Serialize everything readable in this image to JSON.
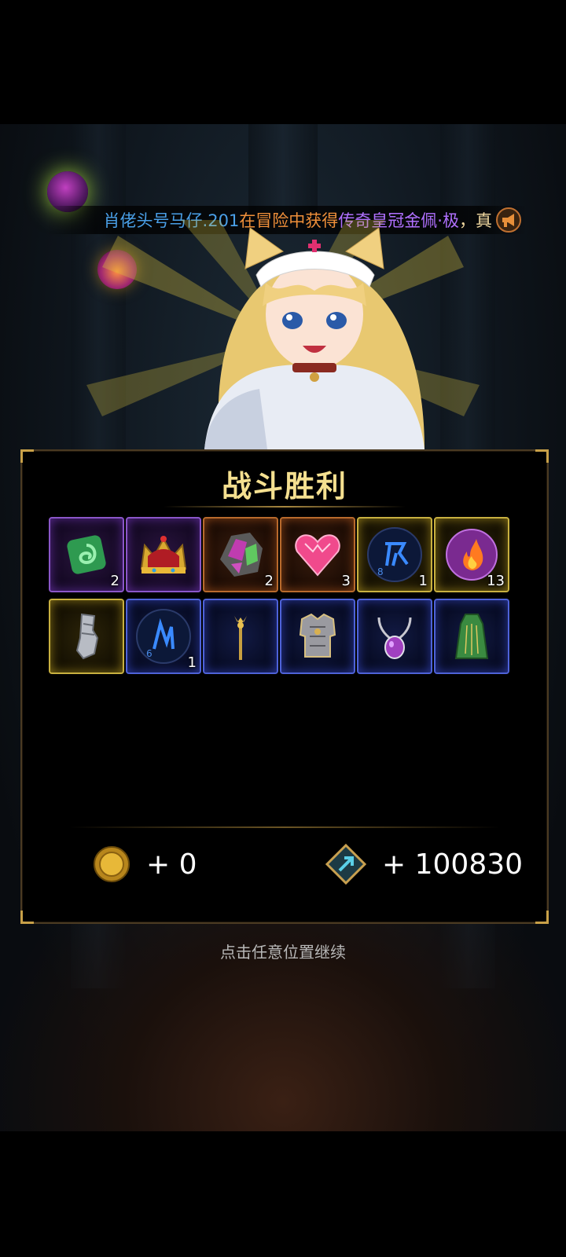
{
  "broadcast": {
    "player_name": "肖佬头号马仔.201",
    "action": "在冒险中获得",
    "item": "传奇皇冠金佩·极",
    "tail": "，真",
    "icon": "megaphone-icon"
  },
  "panel": {
    "title": "战斗胜利",
    "rows": [
      [
        {
          "icon": "green-rune-stone",
          "quality": "purple",
          "count": "2"
        },
        {
          "icon": "royal-crown",
          "quality": "purple",
          "count": ""
        },
        {
          "icon": "purple-crystal-ore",
          "quality": "orange",
          "count": "2"
        },
        {
          "icon": "pink-heart-gem",
          "quality": "orange",
          "count": "3"
        },
        {
          "icon": "blue-rune-orb-8",
          "quality": "gold",
          "count": "1"
        },
        {
          "icon": "fire-orb",
          "quality": "gold",
          "count": "13"
        }
      ],
      [
        {
          "icon": "steel-gauntlet",
          "quality": "gold",
          "count": ""
        },
        {
          "icon": "blue-rune-orb-6",
          "quality": "blue",
          "count": "1"
        },
        {
          "icon": "golden-scepter",
          "quality": "blue",
          "count": ""
        },
        {
          "icon": "silver-armor",
          "quality": "blue",
          "count": ""
        },
        {
          "icon": "amethyst-amulet",
          "quality": "blue",
          "count": ""
        },
        {
          "icon": "green-cloak",
          "quality": "blue",
          "count": ""
        }
      ]
    ],
    "rune_numbers": {
      "orb8": "8",
      "orb6": "6"
    },
    "rewards": {
      "gold": {
        "icon": "gold-coin-icon",
        "value": "+ 0"
      },
      "exp": {
        "icon": "exp-arrow-icon",
        "value": "+ 100830"
      }
    }
  },
  "hint": "点击任意位置继续",
  "colors": {
    "title": "#f5e090",
    "purple": "#8a56c8",
    "orange": "#b86a2c",
    "gold": "#c8b040",
    "blue": "#4e62d8"
  }
}
